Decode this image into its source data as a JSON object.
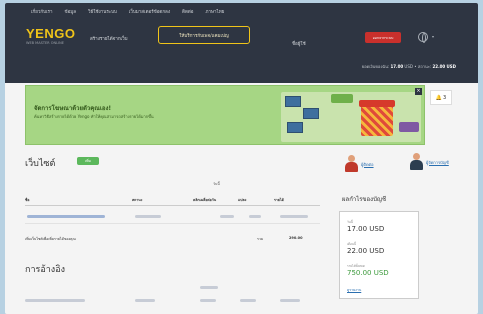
{
  "topnav": [
    "เกี่ยวกับเรา",
    "ข้อมูล",
    "วิธีใช้งานระบบ",
    "เว็บมาสเตอร์ข้อตกลง",
    "ติดต่อ",
    "ภาษาไทย"
  ],
  "header": {
    "logo": "YENGO",
    "logo_sub": "WEB MASTER ONLINE",
    "nav_link": "สร้างรายได้จากเว็บ",
    "nav_active": "ให้บริการกับเพจ/แคมเปญ",
    "user_name": "ชื่อผู้ใช้",
    "red_button": "ออกจากระบบ",
    "lang_caret": "▾",
    "balance_label_1": "ยอดเงินของฉัน:",
    "balance_value_1": "17.00",
    "balance_label_2": "USD • สถานะ:",
    "balance_value_2": "22.00 USD"
  },
  "banner": {
    "title": "จัดการโฆษณาด้วยตัวคุณเอง!",
    "subtitle": "ค้นหาวิธีสร้างรายได้ด้วย Yengo ทำให้คุณสามารถสร้างรายได้มากขึ้น",
    "close": "×",
    "notif_count": "3"
  },
  "websites": {
    "title": "เว็บไซต์",
    "add_badge": "เพิ่ม",
    "person1": "ผู้ติดต่อ",
    "person2": "ผู้จัดการบัญชี",
    "col_top": "วันนี้",
    "columns": [
      "ชื่อ",
      "สถานะ",
      "คลิกเฉลี่ยต่อวัน",
      "แปลง",
      "รายได้"
    ],
    "footer_label": "เพิ่มเว็บไซต์เพื่อเพิ่มรายได้ของคุณ",
    "footer_total_label": "รวม",
    "footer_total_value": "290.00"
  },
  "summary": {
    "title": "ผลกำไรของบัญชี",
    "label1": "วันนี้",
    "value1": "17.00 USD",
    "label2": "เดือนนี้",
    "value2": "22.00 USD",
    "label3": "รายได้ทั้งหมด",
    "value3": "750.00 USD",
    "link": "ดูรายงาน"
  },
  "referrals": {
    "title": "การอ้างอิง"
  }
}
